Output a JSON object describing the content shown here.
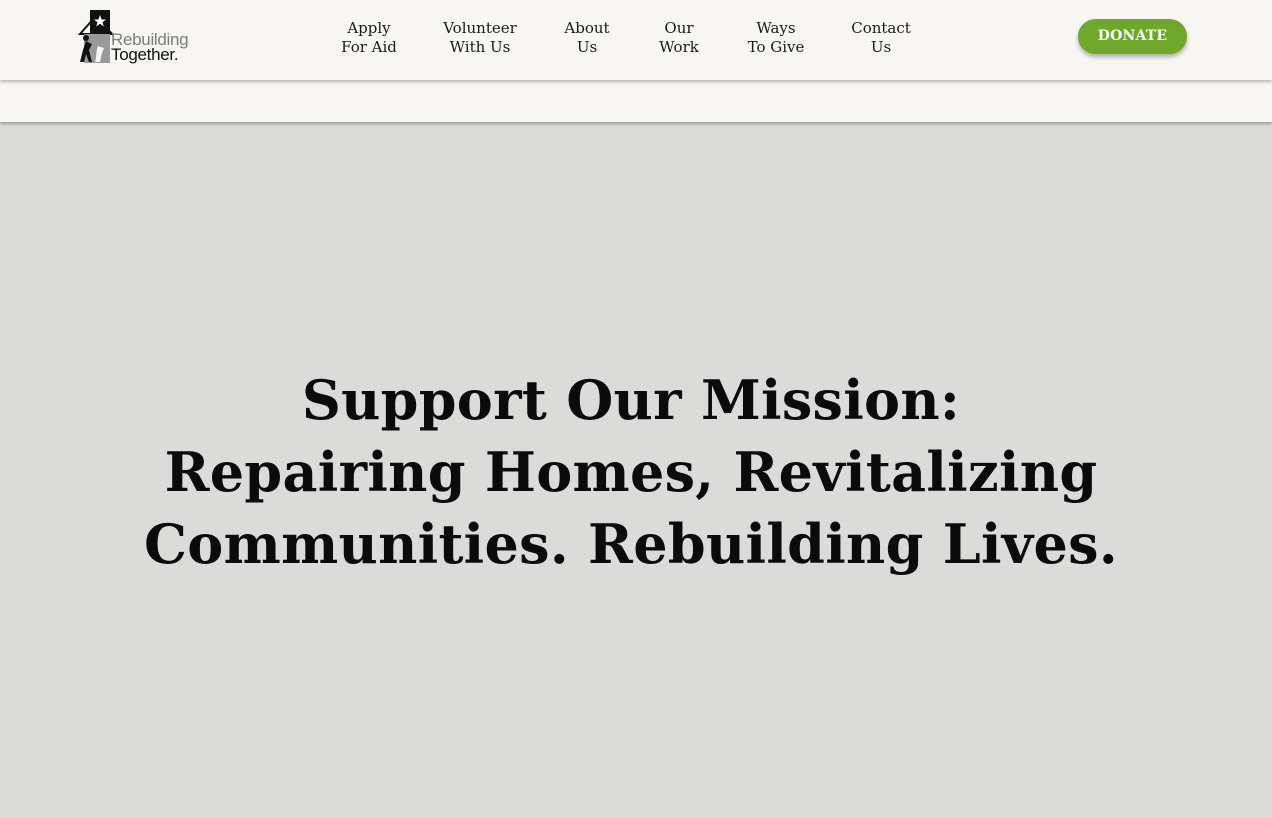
{
  "logo": {
    "line1": "Rebuilding",
    "line2": "Together.",
    "icon": "house-star-logo-icon"
  },
  "nav": {
    "items": [
      {
        "line1": "Apply",
        "line2": "For Aid"
      },
      {
        "line1": "Volunteer",
        "line2": "With Us"
      },
      {
        "line1": "About",
        "line2": "Us"
      },
      {
        "line1": "Our",
        "line2": "Work"
      },
      {
        "line1": "Ways",
        "line2": "To Give"
      },
      {
        "line1": "Contact",
        "line2": "Us"
      }
    ]
  },
  "donate": {
    "label": "DONATE"
  },
  "hero": {
    "lines": [
      "Support Our Mission:",
      "Repairing Homes, Revitalizing",
      "Communities. Rebuilding Lives."
    ]
  },
  "colors": {
    "header_bg": "#f7f6f2",
    "hero_bg": "#dbdbda",
    "donate_bg": "#6ea72a",
    "text": "#0b0b0b"
  }
}
